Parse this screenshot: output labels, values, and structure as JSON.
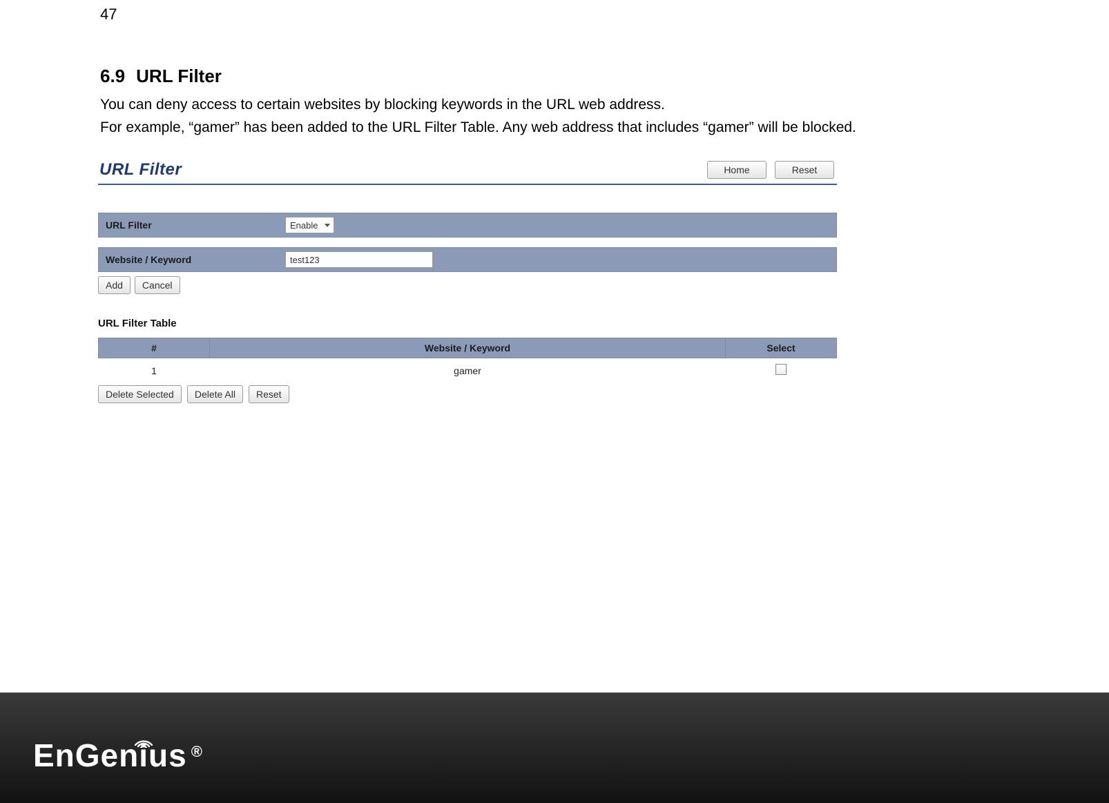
{
  "page": {
    "number": "47"
  },
  "section": {
    "number": "6.9",
    "title": "URL Filter"
  },
  "intro": {
    "line1": "You can deny access to certain websites by blocking keywords in the URL web address.",
    "line2": "For example, “gamer” has been added to the URL Filter Table. Any web address that includes “gamer” will be blocked."
  },
  "panel": {
    "title": "URL Filter",
    "home_btn": "Home",
    "reset_btn": "Reset",
    "url_filter_label": "URL Filter",
    "url_filter_value": "Enable",
    "keyword_label": "Website / Keyword",
    "keyword_value": "test123",
    "add_btn": "Add",
    "cancel_btn": "Cancel"
  },
  "table": {
    "heading": "URL Filter Table",
    "cols": {
      "idx": "#",
      "kw": "Website / Keyword",
      "sel": "Select"
    },
    "rows": [
      {
        "idx": "1",
        "kw": "gamer"
      }
    ],
    "actions": {
      "del_sel": "Delete Selected",
      "del_all": "Delete All",
      "reset": "Reset"
    }
  },
  "footer": {
    "brand_a": "EnGen",
    "brand_b": "us",
    "reg": "®"
  }
}
